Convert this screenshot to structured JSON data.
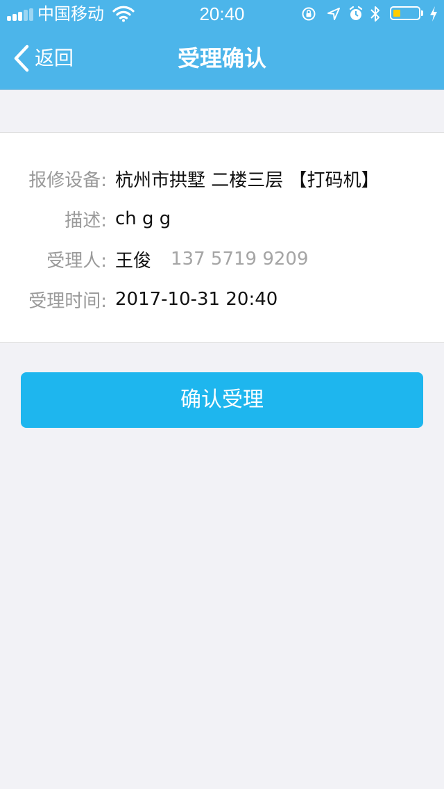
{
  "status_bar": {
    "carrier": "中国移动",
    "time": "20:40",
    "battery_level": 0.3,
    "battery_color": "#ffcc00"
  },
  "nav": {
    "back_label": "返回",
    "title": "受理确认"
  },
  "details": {
    "equipment_label": "报修设备:",
    "equipment_value": "杭州市拱墅 二楼三层 【打码机】",
    "description_label": "描述:",
    "description_value": "ch g g",
    "handler_label": "受理人:",
    "handler_name": "王俊",
    "handler_phone": "137 5719 9209",
    "time_label": "受理时间:",
    "time_value": "2017-10-31 20:40"
  },
  "actions": {
    "confirm_label": "确认受理"
  },
  "colors": {
    "header": "#4cb5ea",
    "button": "#1eb6ee",
    "background": "#f2f2f6"
  }
}
